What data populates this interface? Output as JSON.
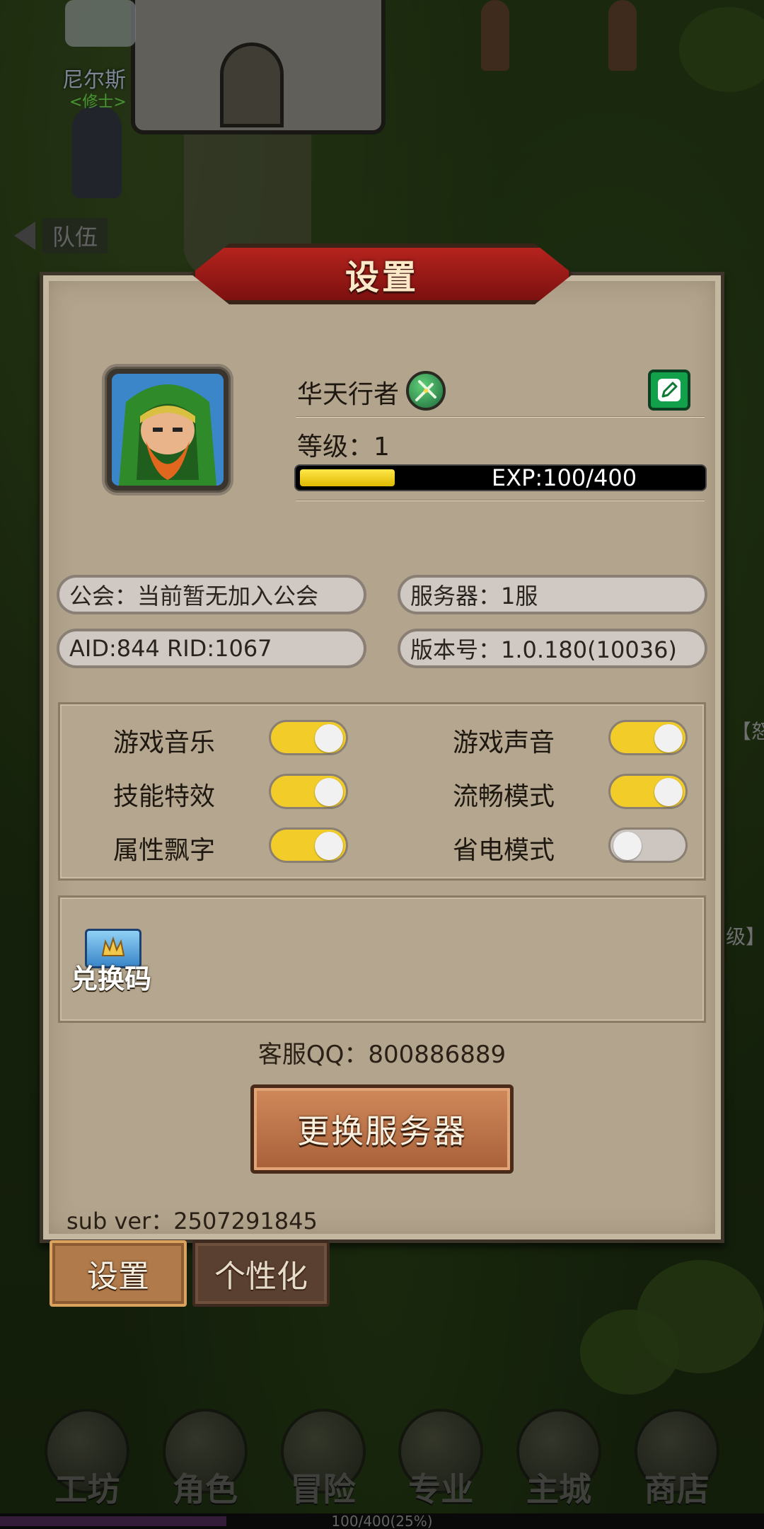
{
  "scene": {
    "npc_name": "尼尔斯",
    "npc_title": "<修士>",
    "team_label": "队伍",
    "side_text_1": "【怒",
    "side_text_2": "级】"
  },
  "dialog": {
    "title": "设置",
    "player": {
      "name": "华天行者",
      "level_text": "等级：1",
      "exp_text": "EXP:100/400",
      "exp_progress": 0.25
    },
    "info": {
      "guild": "公会：当前暂无加入公会",
      "server": "服务器：1服",
      "ids": "AID:844  RID:1067",
      "version": "版本号：1.0.180(10036)"
    },
    "toggles": [
      {
        "label": "游戏音乐",
        "on": true
      },
      {
        "label": "游戏声音",
        "on": true
      },
      {
        "label": "技能特效",
        "on": true
      },
      {
        "label": "流畅模式",
        "on": true
      },
      {
        "label": "属性飘字",
        "on": true
      },
      {
        "label": "省电模式",
        "on": false
      }
    ],
    "redeem_label": "兑换码",
    "support_qq": "客服QQ：800886889",
    "change_server": "更换服务器",
    "sub_ver": "sub ver：2507291845"
  },
  "tabs": {
    "settings": "设置",
    "personalize": "个性化"
  },
  "bottom_nav": [
    "工坊",
    "角色",
    "冒险",
    "专业",
    "主城",
    "商店"
  ],
  "bottom_bar_text": "100/400(25%)",
  "colors": {
    "toggle_on": "#f2cd2a",
    "toggle_off": "#cdc6c0",
    "banner_red": "#b5231e",
    "edit_green": "#12a14a"
  }
}
